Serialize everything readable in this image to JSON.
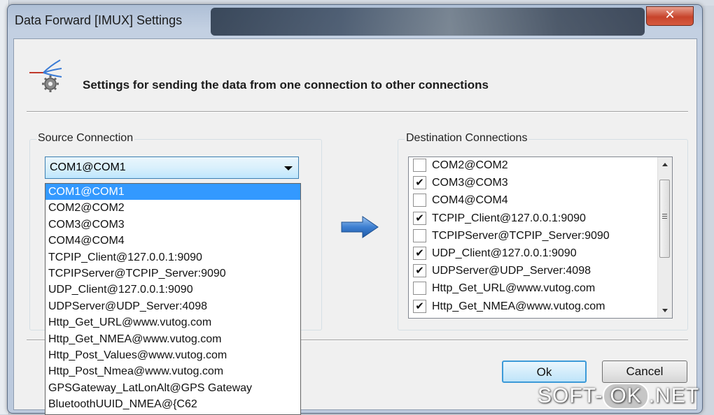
{
  "window": {
    "title": "Data Forward [IMUX] Settings",
    "close_glyph": "✕"
  },
  "header": {
    "icon": "forward-gear-icon",
    "text": "Settings for sending the data from one connection to other connections"
  },
  "source": {
    "label": "Source Connection",
    "selected": "COM1@COM1",
    "options": [
      "COM1@COM1",
      "COM2@COM2",
      "COM3@COM3",
      "COM4@COM4",
      "TCPIP_Client@127.0.0.1:9090",
      "TCPIPServer@TCPIP_Server:9090",
      "UDP_Client@127.0.0.1:9090",
      "UDPServer@UDP_Server:4098",
      "Http_Get_URL@www.vutog.com",
      "Http_Get_NMEA@www.vutog.com",
      "Http_Post_Values@www.vutog.com",
      "Http_Post_Nmea@www.vutog.com",
      "GPSGateway_LatLonAlt@GPS Gateway",
      "BluetoothUUID_NMEA@{C62"
    ]
  },
  "destination": {
    "label": "Destination Connections",
    "items": [
      {
        "label": "COM2@COM2",
        "checked": false
      },
      {
        "label": "COM3@COM3",
        "checked": true
      },
      {
        "label": "COM4@COM4",
        "checked": false
      },
      {
        "label": "TCPIP_Client@127.0.0.1:9090",
        "checked": true
      },
      {
        "label": "TCPIPServer@TCPIP_Server:9090",
        "checked": false
      },
      {
        "label": "UDP_Client@127.0.0.1:9090",
        "checked": true
      },
      {
        "label": "UDPServer@UDP_Server:4098",
        "checked": true
      },
      {
        "label": "Http_Get_URL@www.vutog.com",
        "checked": false
      },
      {
        "label": "Http_Get_NMEA@www.vutog.com",
        "checked": true
      }
    ]
  },
  "buttons": {
    "ok": "Ok",
    "cancel": "Cancel"
  },
  "watermark": {
    "prefix": "SOFT-",
    "ok": "OK",
    "suffix": ".NET"
  },
  "colors": {
    "selection": "#3399ff",
    "focus_border": "#3c9ad8",
    "close_button": "#c7442b"
  }
}
